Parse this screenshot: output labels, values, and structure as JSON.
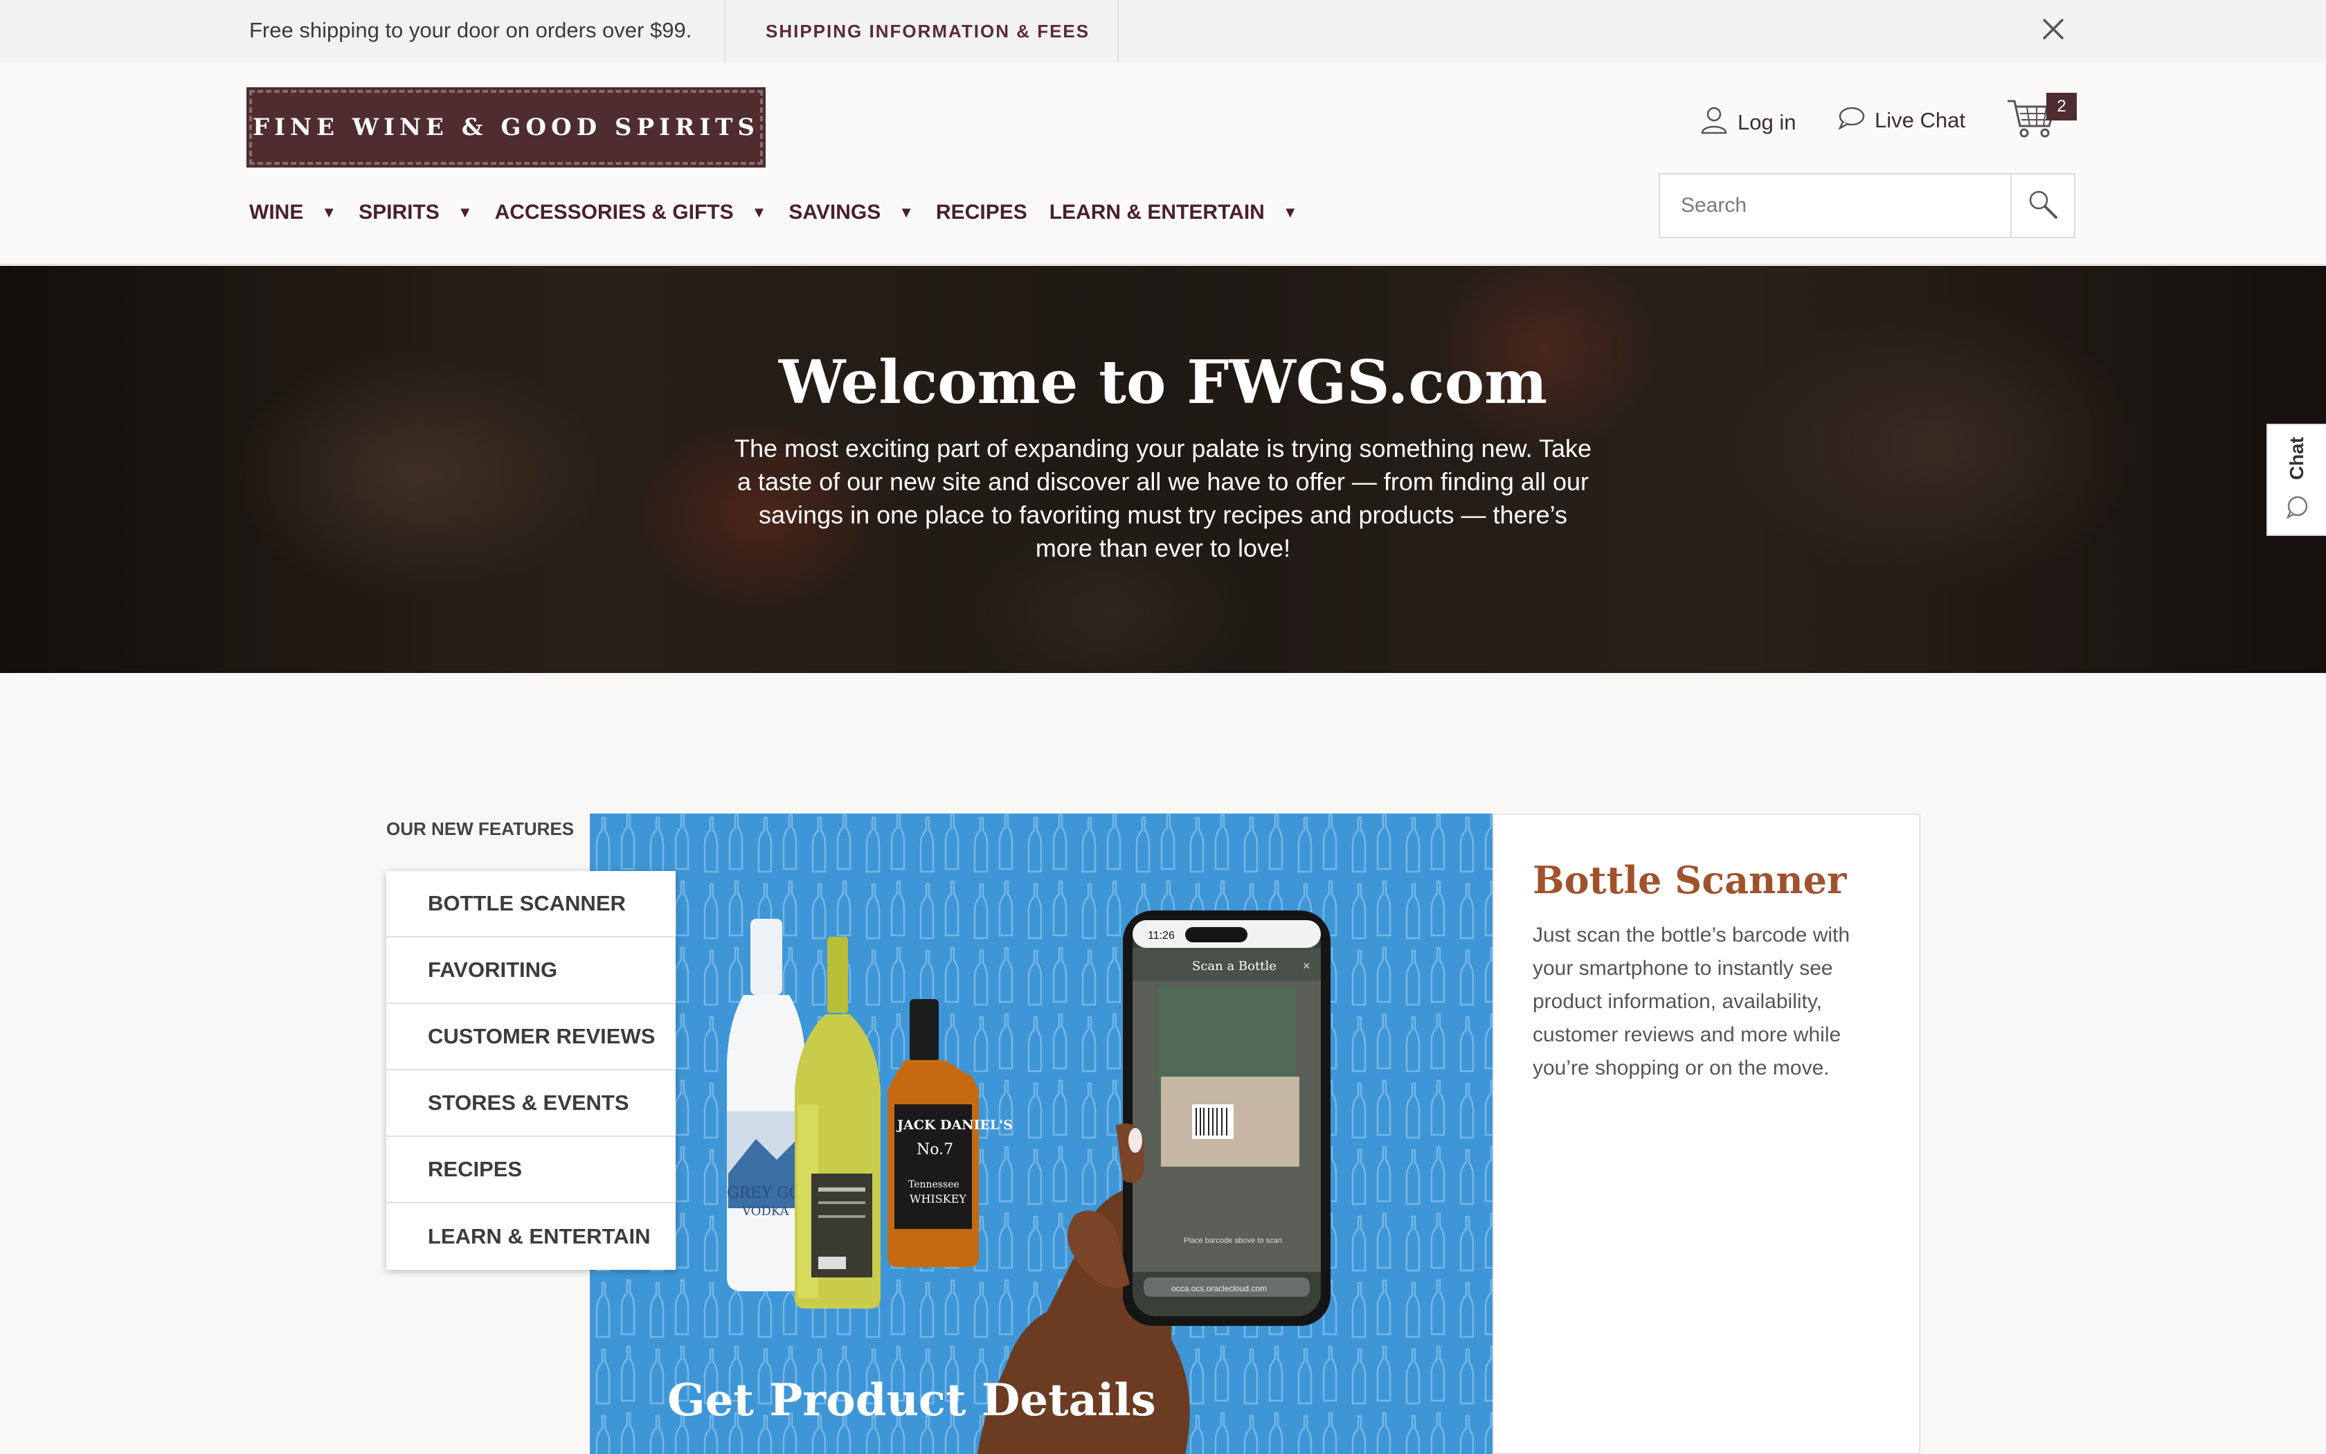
{
  "promo": {
    "shipping_text": "Free shipping to your door on orders over $99.",
    "shipping_link": "SHIPPING INFORMATION & FEES"
  },
  "header": {
    "logo_text": "FINE WINE & GOOD SPIRITS",
    "login_label": "Log in",
    "live_chat_label": "Live Chat",
    "cart_count": "2",
    "search_placeholder": "Search"
  },
  "nav": {
    "items": [
      {
        "label": "WINE",
        "has_dropdown": true
      },
      {
        "label": "SPIRITS",
        "has_dropdown": true
      },
      {
        "label": "ACCESSORIES & GIFTS",
        "has_dropdown": true
      },
      {
        "label": "SAVINGS",
        "has_dropdown": true
      },
      {
        "label": "RECIPES",
        "has_dropdown": false
      },
      {
        "label": "LEARN & ENTERTAIN",
        "has_dropdown": true
      }
    ],
    "caret": "▼"
  },
  "hero": {
    "title": "Welcome to FWGS.com",
    "body": "The most exciting part of expanding your palate is trying something new. Take a taste of our new site and discover all we have to offer — from finding all our savings in one place to favoriting must try recipes and products — there’s more than ever to love!"
  },
  "chat_tab": {
    "label": "Chat"
  },
  "features": {
    "heading": "OUR NEW FEATURES",
    "menu": [
      "BOTTLE SCANNER",
      "FAVORITING",
      "CUSTOMER REVIEWS",
      "STORES & EVENTS",
      "RECIPES",
      "LEARN & ENTERTAIN"
    ],
    "active_title": "Bottle Scanner",
    "active_description": "Just scan the bottle’s barcode with your smartphone to instantly see product information, availability, customer reviews and more while you’re shopping or on the move.",
    "image_caption": "Get Product Details",
    "phone": {
      "time": "11:26",
      "screen_title": "Scan a Bottle",
      "close_glyph": "×",
      "hint": "Place barcode above to scan",
      "url": "occa.ocs.oraclecloud.com"
    },
    "bottles": {
      "vodka": "GREY GOOSE",
      "vodka_sub": "VODKA",
      "whiskey": "JACK DANIEL'S",
      "whiskey_no": "No.7",
      "whiskey_sub": "WHISKEY"
    }
  },
  "colors": {
    "brand": "#4e2c2f",
    "accent_title": "#a0522d",
    "image_blue": "#3f96d6"
  }
}
